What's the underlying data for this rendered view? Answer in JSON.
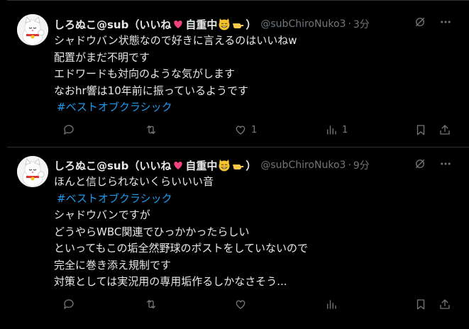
{
  "tweets": [
    {
      "display_name": "しろぬこ@sub（いいね",
      "name_mid": "自重中",
      "name_end": "）",
      "handle": "@subChiroNuko3",
      "separator": "·",
      "time": "3分",
      "lines": [
        "シャドウバン状態なので好きに言えるのはいいねw",
        "配置がまだ不明です",
        "エドワードも対向のような気がします",
        "なおhr響は10年前に振っているようです"
      ],
      "hashtag": "#ベストオブクラシック",
      "likes": "1",
      "views": "1"
    },
    {
      "display_name": "しろぬこ@sub（いいね",
      "name_mid": "自重中",
      "name_end": "）",
      "handle": "@subChiroNuko3",
      "separator": "·",
      "time": "9分",
      "first_line": "ほんと信じられないくらいいい音",
      "hashtag": "#ベストオブクラシック",
      "lines": [
        "シャドウバンですが",
        "どうやらWBC関連でひっかかったらしい",
        "といってもこの垢全然野球のポストをしていないので",
        "完全に巻き添え規制です",
        "対策としては実況用の専用垢作るしかなさそう..."
      ]
    }
  ],
  "icons": {
    "avatar": "maneki-neko-avatar",
    "grok": "grok-icon",
    "more": "more-icon",
    "reply": "reply-icon",
    "retweet": "retweet-icon",
    "like": "heart-icon",
    "views": "views-icon",
    "bookmark": "bookmark-icon",
    "share": "share-icon"
  },
  "colors": {
    "background": "#000000",
    "text": "#e7e9ea",
    "muted": "#71767b",
    "link": "#1d9bf0",
    "divider": "#2f3336"
  }
}
